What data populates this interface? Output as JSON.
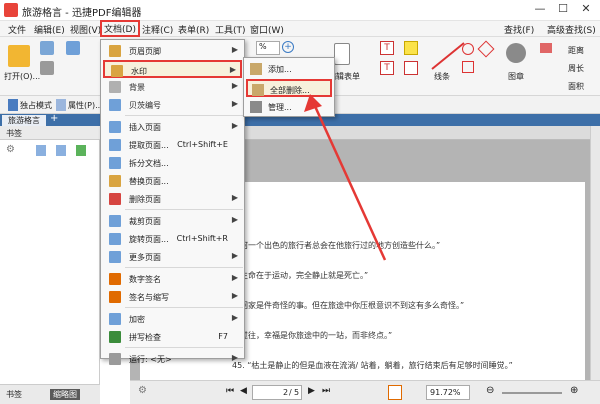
{
  "window": {
    "title": "旅游格言 - 迅捷PDF编辑器"
  },
  "menubar": {
    "items": [
      "文件",
      "编辑(E)",
      "视图(V)",
      "文档(D)",
      "注释(C)",
      "表单(R)",
      "工具(T)",
      "窗口(W)"
    ],
    "right_items": [
      "查找(F)",
      "高级查找(S)"
    ]
  },
  "toolbar": {
    "open_label": "打开(O)...",
    "zoom_value": "%",
    "edit_form_label": "编辑表单",
    "lines_label": "线条",
    "stamp_label": "图章",
    "distance_label": "距离",
    "perimeter_label": "周长",
    "area_label": "面积",
    "exclusive_mode_label": "独占模式",
    "properties_label": "属性(P)..."
  },
  "tabs": {
    "doc_tab": "旅游格言"
  },
  "left_pane": {
    "header": "书签",
    "bottom_tab_bookmarks": "书签",
    "bottom_tab_thumbs": "缩略图"
  },
  "doc_menu": {
    "items": [
      {
        "label": "页眉页脚",
        "submenu": true
      },
      {
        "label": "水印",
        "submenu": true,
        "highlighted": true
      },
      {
        "label": "背景",
        "submenu": true
      },
      {
        "label": "贝茨编号",
        "submenu": true
      },
      {
        "label": "插入页面",
        "submenu": true
      },
      {
        "label": "提取页面...",
        "shortcut": "Ctrl+Shift+E"
      },
      {
        "label": "拆分文档..."
      },
      {
        "label": "替换页面..."
      },
      {
        "label": "删除页面",
        "submenu": true
      },
      {
        "label": "裁剪页面",
        "submenu": true
      },
      {
        "label": "旋转页面...",
        "shortcut": "Ctrl+Shift+R"
      },
      {
        "label": "更多页面",
        "submenu": true
      },
      {
        "label": "数字签名",
        "submenu": true
      },
      {
        "label": "签名与缩写",
        "submenu": true
      },
      {
        "label": "加密",
        "submenu": true
      },
      {
        "label": "拼写检查",
        "shortcut": "F7"
      },
      {
        "label": "运行: <无>",
        "submenu": true
      }
    ]
  },
  "watermark_submenu": {
    "items": [
      "添加...",
      "全部删除...",
      "管理..."
    ]
  },
  "document": {
    "lines": [
      "何一个出色的旅行者总会在他旅行过的地方创造些什么。”",
      "生命在于运动，完全静止就是死亡。”",
      "回家是件奇怪的事。但在旅途中你压根意识不到这有多么奇怪。”",
      "过往，幸福是你旅途中的一站，而非终点。”",
      "45.  “枯土是静止的但是血液在流淌/ 站着，躺着，旅行结束后有足够时间睡觉。”"
    ]
  },
  "status": {
    "page_current": "2",
    "page_total": "5",
    "zoom": "91.72%"
  },
  "colors": {
    "accent_red": "#e53935",
    "tab_blue": "#3d6fa8"
  }
}
